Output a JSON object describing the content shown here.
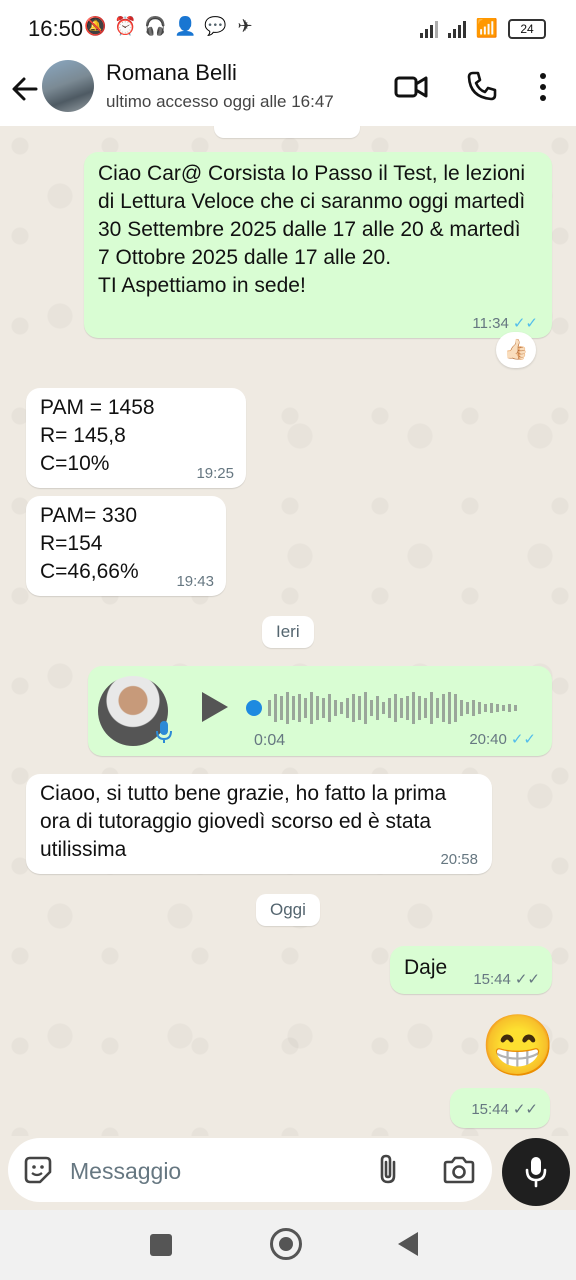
{
  "status_bar": {
    "time": "16:50",
    "battery": "24",
    "icons": [
      "mute-icon",
      "alarm-icon",
      "headset-icon",
      "person-plus-icon",
      "chat-icon",
      "telegram-icon"
    ]
  },
  "header": {
    "name": "Romana Belli",
    "status": "ultimo accesso oggi alle 16:47"
  },
  "messages": [
    {
      "text": "Ciao Car@ Corsista Io Passo il Test, le lezioni di Lettura Veloce che ci saranmo oggi martedì 30 Settembre 2025 dalle 17 alle 20 & martedì 7 Ottobre 2025 dalle 17 alle 20.\nTI Aspettiamo in sede!",
      "time": "11:34",
      "reaction": "👍🏻"
    },
    {
      "text": "PAM = 1458\nR= 145,8\nC=10%",
      "time": "19:25"
    },
    {
      "text": "PAM= 330\nR=154\nC=46,66%",
      "time": "19:43"
    },
    {
      "duration": "0:04",
      "time": "20:40"
    },
    {
      "text": "Ciaoo, si tutto bene grazie, ho fatto la prima ora di tutoraggio giovedì scorso ed è stata utilissima",
      "time": "20:58"
    },
    {
      "text": "Daje",
      "time": "15:44"
    },
    {
      "emoji": "😁",
      "time": "15:44"
    }
  ],
  "date_chips": [
    "Ieri",
    "Oggi"
  ],
  "input": {
    "placeholder": "Messaggio"
  },
  "colors": {
    "outgoing": "#d9fdd3",
    "incoming": "#ffffff",
    "read_tick": "#53bdeb",
    "background": "#efeae2"
  }
}
